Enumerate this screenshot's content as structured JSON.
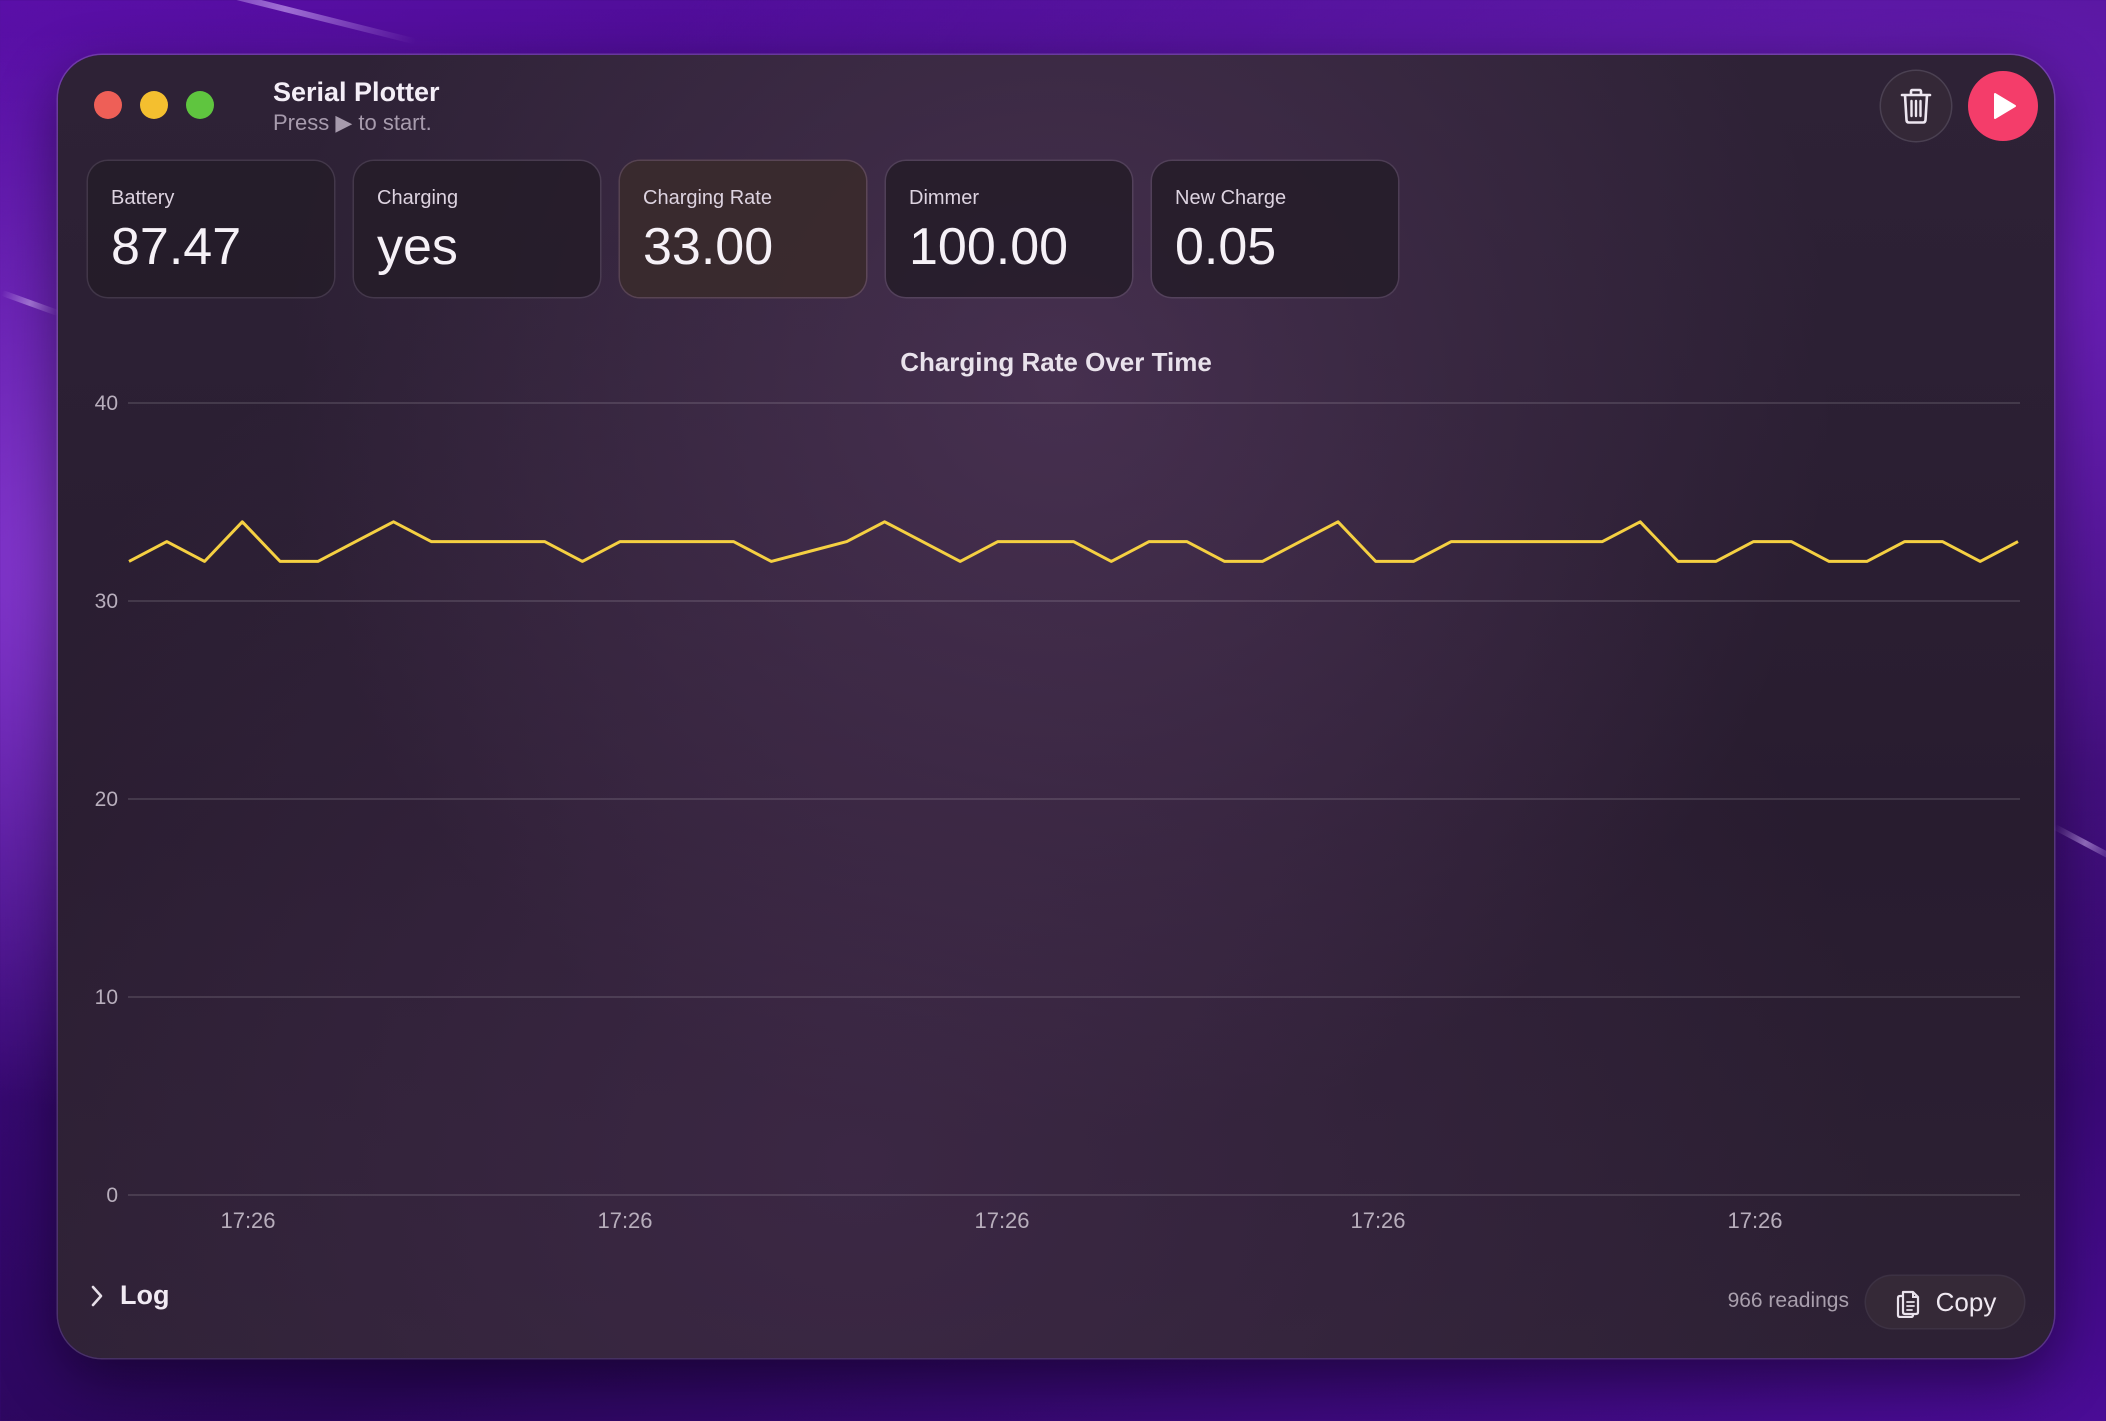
{
  "window": {
    "title": "Serial Plotter",
    "subtitle": "Press ▶ to start."
  },
  "toolbar": {
    "trash_icon": "trash-icon",
    "play_icon": "play-icon",
    "play_color": "#f43d6a"
  },
  "cards": [
    {
      "label": "Battery",
      "value": "87.47"
    },
    {
      "label": "Charging",
      "value": "yes"
    },
    {
      "label": "Charging Rate",
      "value": "33.00",
      "selected": true
    },
    {
      "label": "Dimmer",
      "value": "100.00"
    },
    {
      "label": "New Charge",
      "value": "0.05"
    }
  ],
  "chart_data": {
    "type": "line",
    "title": "Charging Rate Over Time",
    "xlabel": "",
    "ylabel": "",
    "ylim": [
      0,
      40
    ],
    "yticks": [
      "0",
      "10",
      "20",
      "30",
      "40"
    ],
    "xtick_labels": [
      "17:26",
      "17:26",
      "17:26",
      "17:26",
      "17:26"
    ],
    "grid": true,
    "line_color": "#f5d042",
    "series": [
      {
        "values": [
          32,
          33,
          32,
          34,
          32,
          32,
          33,
          34,
          33,
          33,
          33,
          33,
          32,
          33,
          33,
          33,
          33,
          32,
          32.5,
          33,
          34,
          33,
          32,
          33,
          33,
          33,
          32,
          33,
          33,
          32,
          32,
          33,
          34,
          32,
          32,
          33,
          33,
          33,
          33,
          33,
          34,
          32,
          32,
          33,
          33,
          32,
          32,
          33,
          33,
          32,
          33
        ]
      }
    ]
  },
  "footer": {
    "log_label": "Log",
    "readings": "966 readings",
    "copy_label": "Copy"
  }
}
